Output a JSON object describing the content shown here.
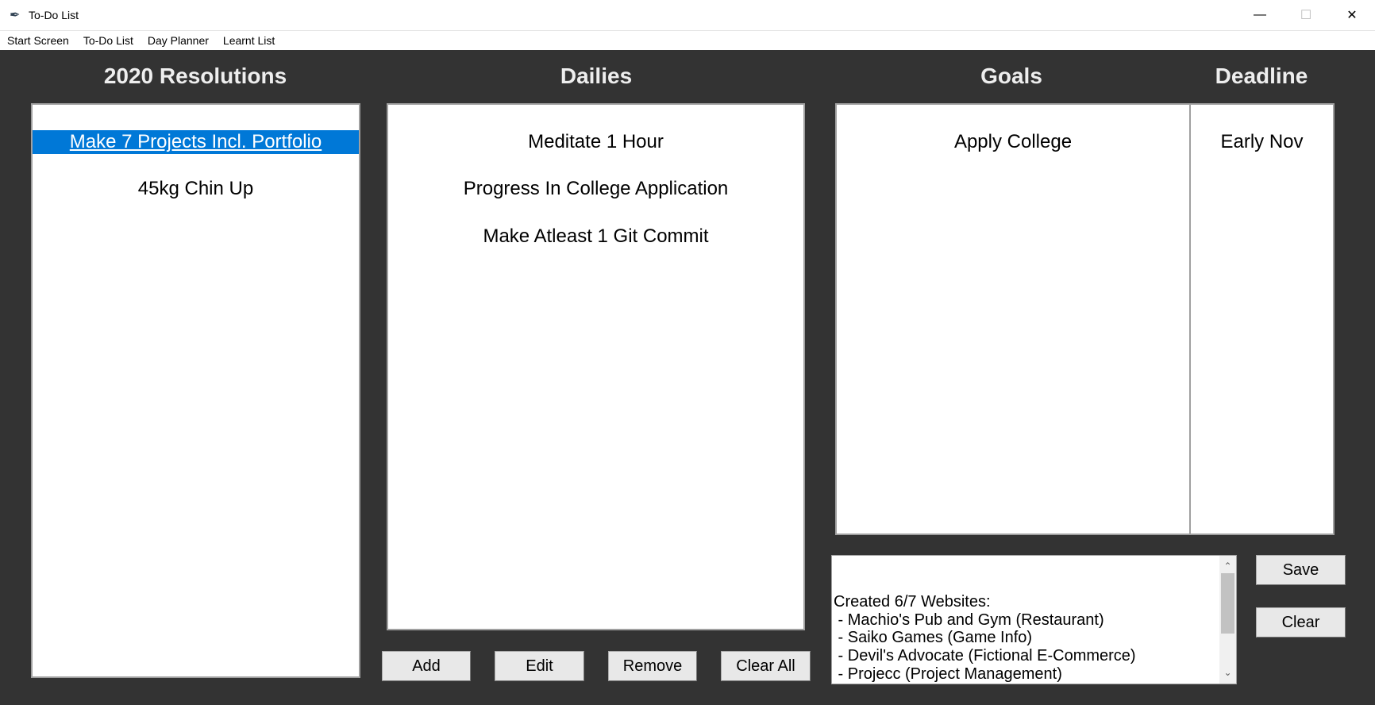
{
  "window": {
    "title": "To-Do List",
    "minimize": "—",
    "maximize": "☐",
    "close": "✕"
  },
  "menu": [
    "Start Screen",
    "To-Do List",
    "Day Planner",
    "Learnt List"
  ],
  "headings": {
    "resolutions": "2020 Resolutions",
    "dailies": "Dailies",
    "goals": "Goals",
    "deadline": "Deadline"
  },
  "resolutions": [
    "Make 7 Projects Incl. Portfolio",
    "45kg Chin Up"
  ],
  "dailies": [
    "Meditate 1 Hour",
    "Progress In College Application",
    "Make Atleast 1 Git Commit"
  ],
  "goals": [
    "Apply College"
  ],
  "deadlines": [
    "Early Nov"
  ],
  "buttons": {
    "add": "Add",
    "edit": "Edit",
    "remove": "Remove",
    "clear_all": "Clear All",
    "save": "Save",
    "clear": "Clear"
  },
  "notes": "Created 6/7 Websites:\n - Machio's Pub and Gym (Restaurant)\n - Saiko Games (Game Info)\n - Devil's Advocate (Fictional E-Commerce)\n - Projecc (Project Management)\n - Portfolio\n - Benefitted (Landing Page)"
}
